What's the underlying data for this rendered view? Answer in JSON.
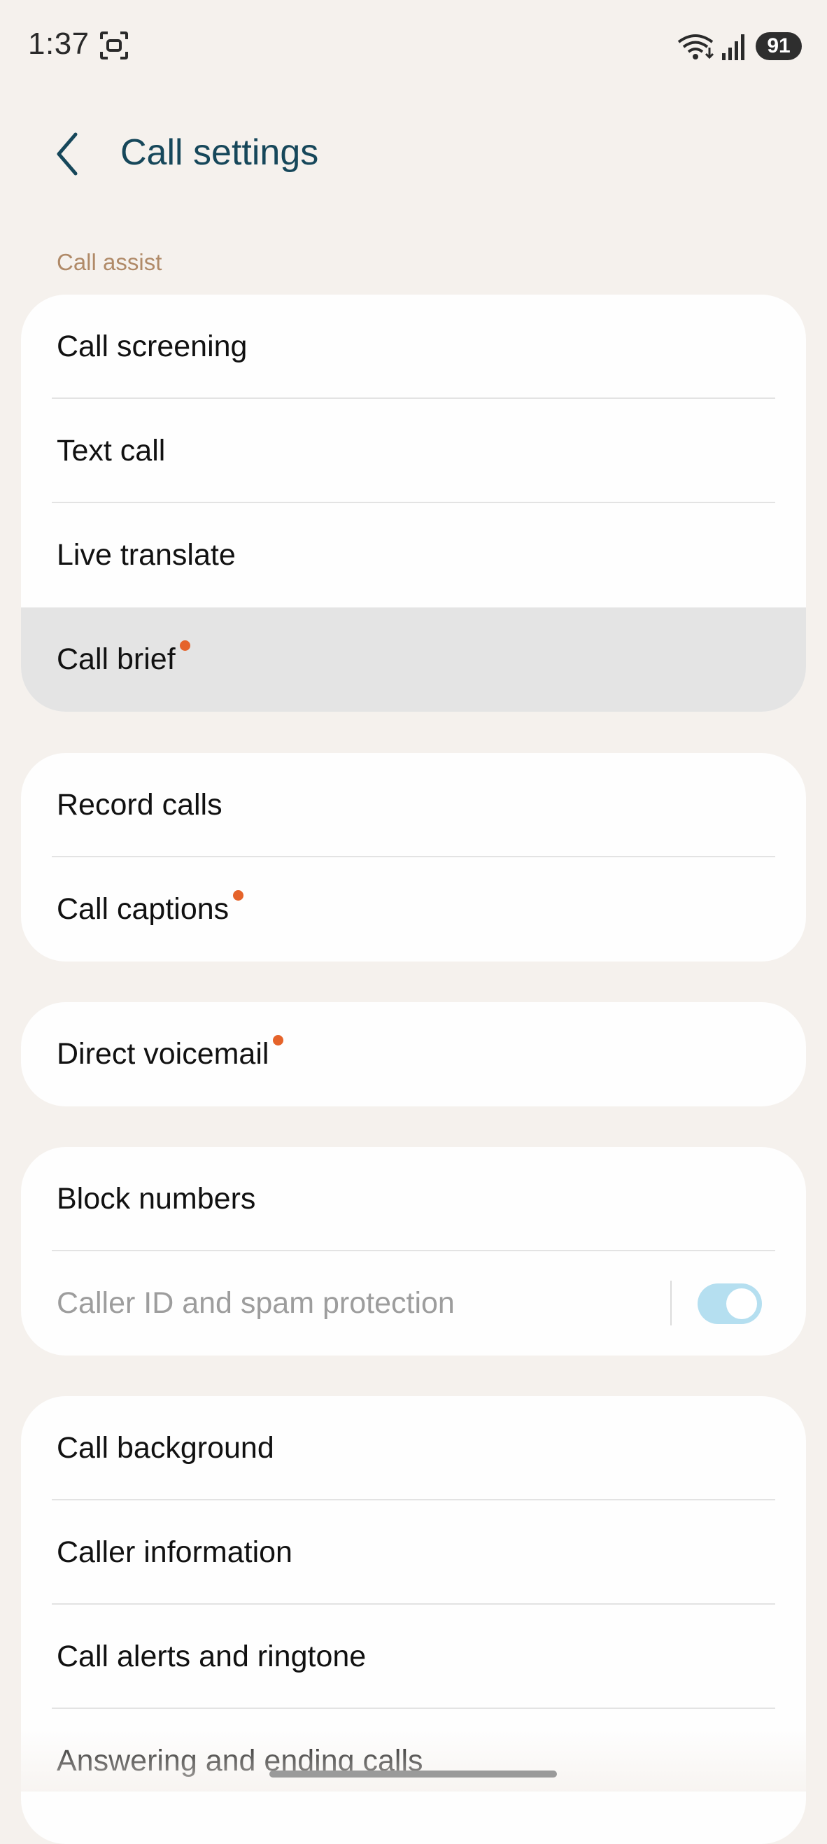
{
  "status_bar": {
    "time": "1:37",
    "battery": "91"
  },
  "header": {
    "title": "Call settings"
  },
  "section": {
    "label": "Call assist"
  },
  "cards": {
    "call_assist": {
      "items": [
        {
          "label": "Call screening"
        },
        {
          "label": "Text call"
        },
        {
          "label": "Live translate"
        },
        {
          "label": "Call brief"
        }
      ]
    },
    "recording": {
      "items": [
        {
          "label": "Record calls"
        },
        {
          "label": "Call captions"
        }
      ]
    },
    "voicemail": {
      "items": [
        {
          "label": "Direct voicemail"
        }
      ]
    },
    "blocking": {
      "items": [
        {
          "label": "Block numbers"
        },
        {
          "label": "Caller ID and spam protection",
          "toggle": 1
        }
      ]
    },
    "appearance": {
      "items": [
        {
          "label": "Call background"
        },
        {
          "label": "Caller information"
        },
        {
          "label": "Call alerts and ringtone"
        },
        {
          "label": "Answering and ending calls"
        }
      ]
    }
  },
  "colors": {
    "title": "#16475a",
    "section_label": "#b08a68",
    "badge": "#e5632a",
    "toggle_track": "#b5dff0",
    "background": "#f5f1ed"
  }
}
